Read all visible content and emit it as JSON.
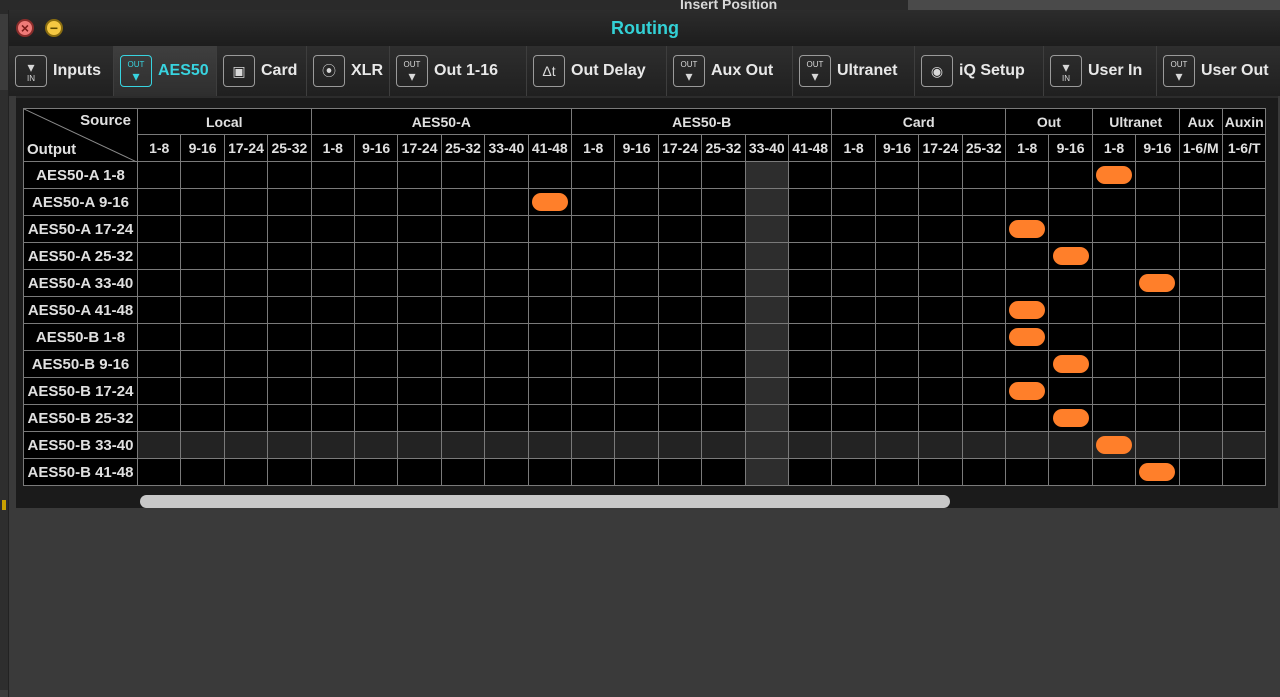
{
  "window": {
    "title": "Routing"
  },
  "background": {
    "insert_label": "Insert Position"
  },
  "tabs": [
    {
      "label": "Inputs",
      "icon": "in-icon",
      "active": false
    },
    {
      "label": "AES50",
      "icon": "out-icon",
      "active": true
    },
    {
      "label": "Card",
      "icon": "card-icon",
      "active": false
    },
    {
      "label": "XLR",
      "icon": "xlr-icon",
      "active": false
    },
    {
      "label": "Out 1-16",
      "icon": "out-icon",
      "active": false
    },
    {
      "label": "Out Delay",
      "icon": "delta-t-icon",
      "active": false
    },
    {
      "label": "Aux Out",
      "icon": "out-icon",
      "active": false
    },
    {
      "label": "Ultranet",
      "icon": "out-icon",
      "active": false
    },
    {
      "label": "iQ Setup",
      "icon": "speaker-icon",
      "active": false
    },
    {
      "label": "User In",
      "icon": "in-icon",
      "active": false
    },
    {
      "label": "User Out",
      "icon": "out-icon",
      "active": false
    }
  ],
  "grid": {
    "corner_source": "Source",
    "corner_output": "Output",
    "groups": [
      {
        "label": "Local",
        "span": 4
      },
      {
        "label": "AES50-A",
        "span": 6
      },
      {
        "label": "AES50-B",
        "span": 6
      },
      {
        "label": "Card",
        "span": 4
      },
      {
        "label": "Out",
        "span": 2
      },
      {
        "label": "Ultranet",
        "span": 2
      },
      {
        "label": "Aux",
        "span": 1
      },
      {
        "label": "Auxin",
        "span": 1
      }
    ],
    "columns": [
      "1-8",
      "9-16",
      "17-24",
      "25-32",
      "1-8",
      "9-16",
      "17-24",
      "25-32",
      "33-40",
      "41-48",
      "1-8",
      "9-16",
      "17-24",
      "25-32",
      "33-40",
      "41-48",
      "1-8",
      "9-16",
      "17-24",
      "25-32",
      "1-8",
      "9-16",
      "1-8",
      "9-16",
      "1-6/M",
      "1-6/T"
    ],
    "rows": [
      "AES50-A 1-8",
      "AES50-A 9-16",
      "AES50-A 17-24",
      "AES50-A 25-32",
      "AES50-A 33-40",
      "AES50-A 41-48",
      "AES50-B 1-8",
      "AES50-B 9-16",
      "AES50-B 17-24",
      "AES50-B 25-32",
      "AES50-B 33-40",
      "AES50-B 41-48"
    ],
    "routes": [
      22,
      9,
      20,
      21,
      23,
      20,
      20,
      21,
      20,
      21,
      22,
      23
    ],
    "highlight_column": 14,
    "highlight_row": 10,
    "route_color": "#ff7f2a"
  }
}
